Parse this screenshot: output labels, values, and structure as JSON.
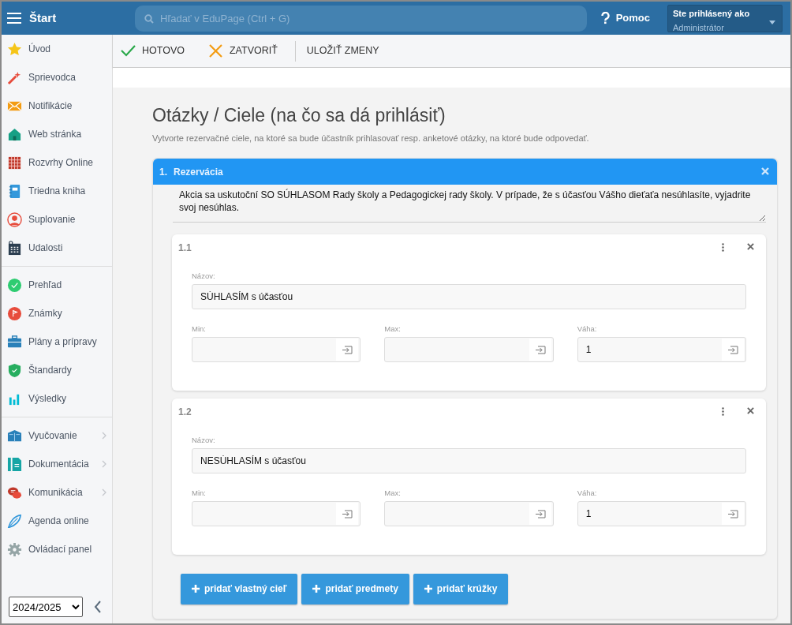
{
  "topbar": {
    "title": "Štart",
    "search": {
      "placeholder": "Hľadať v EduPage (Ctrl + G)"
    },
    "help": "Pomoc",
    "user": {
      "label": "Ste prihlásený ako",
      "value": "Administrátor"
    }
  },
  "toolbar": [
    {
      "label": "HOTOVO",
      "kind": "done"
    },
    {
      "label": "ZATVORIŤ",
      "kind": "close"
    },
    {
      "label": "ULOŽIŤ ZMENY",
      "kind": "save"
    }
  ],
  "sidebar": {
    "groups": [
      [
        {
          "label": "Úvod",
          "has_submenu": false
        },
        {
          "label": "Sprievodca",
          "has_submenu": false
        },
        {
          "label": "Notifikácie",
          "has_submenu": false
        },
        {
          "label": "Web stránka",
          "has_submenu": false
        },
        {
          "label": "Rozvrhy Online",
          "has_submenu": false
        },
        {
          "label": "Triedna kniha",
          "has_submenu": false
        },
        {
          "label": "Suplovanie",
          "has_submenu": false
        },
        {
          "label": "Udalosti",
          "has_submenu": false
        }
      ],
      [
        {
          "label": "Prehľad",
          "has_submenu": false
        },
        {
          "label": "Známky",
          "has_submenu": false
        },
        {
          "label": "Plány a prípravy",
          "has_submenu": false
        },
        {
          "label": "Štandardy",
          "has_submenu": false
        },
        {
          "label": "Výsledky",
          "has_submenu": false
        }
      ],
      [
        {
          "label": "Vyučovanie",
          "has_submenu": true
        },
        {
          "label": "Dokumentácia",
          "has_submenu": true
        },
        {
          "label": "Komunikácia",
          "has_submenu": true
        },
        {
          "label": "Agenda online",
          "has_submenu": false
        },
        {
          "label": "Ovládací panel",
          "has_submenu": false
        }
      ]
    ],
    "year": "2024/2025"
  },
  "page": {
    "title": "Otázky / Ciele (na čo sa dá prihlásiť)",
    "subtitle": "Vytvorte rezervačné ciele, na ktoré sa bude účastník prihlasovať resp. anketové otázky, na ktoré bude odpovedať.",
    "section": {
      "number": "1.",
      "title": "Rezervácia",
      "description": "Akcia sa uskutoční SO SÚHLASOM Rady školy a Pedagogickej rady školy. V prípade, že s účasťou Vášho dieťaťa nesúhlasíte, vyjadrite svoj nesúhlas.",
      "items": [
        {
          "number": "1.1",
          "name_label": "Názov:",
          "name": "SÚHLASÍM s účasťou",
          "fields": [
            {
              "label": "Min:"
            },
            {
              "label": "Max:"
            },
            {
              "label": "Váha:",
              "value": "1"
            }
          ]
        },
        {
          "number": "1.2",
          "name_label": "Názov:",
          "name": "NESÚHLASÍM s účasťou",
          "fields": [
            {
              "label": "Min:"
            },
            {
              "label": "Max:"
            },
            {
              "label": "Váha:",
              "value": "1"
            }
          ]
        }
      ],
      "buttons": [
        "pridať vlastný cieľ",
        "pridať predmety",
        "pridať krúžky"
      ]
    }
  }
}
